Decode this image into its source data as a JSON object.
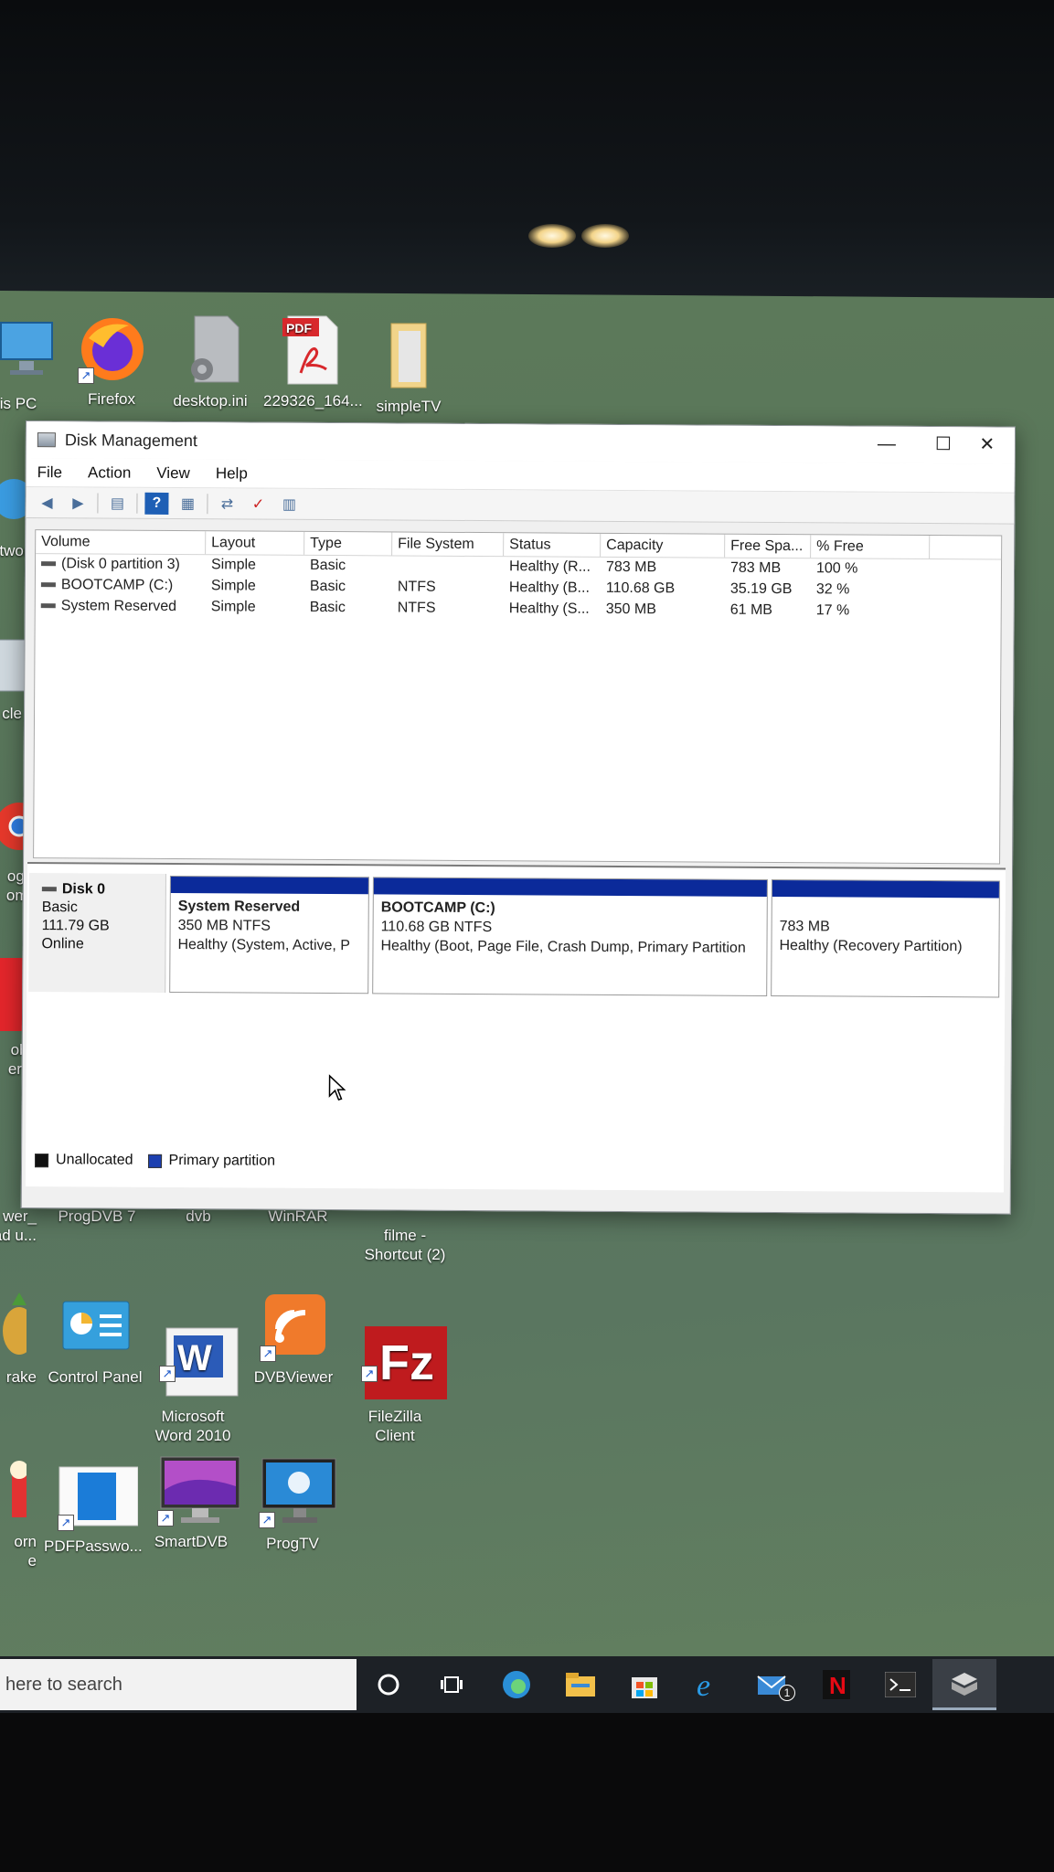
{
  "desktop": {
    "top_icons": [
      {
        "label": "is PC"
      },
      {
        "label": "Firefox"
      },
      {
        "label": "desktop.ini"
      },
      {
        "label": "229326_164..."
      },
      {
        "label": "simpleTV"
      }
    ],
    "left_edge_labels": [
      "twork",
      "cle B",
      "ogle",
      "ome",
      "obe",
      "er X",
      "wer_",
      "ad u...",
      "rake",
      "orn",
      "e"
    ],
    "row2_icons": [
      {
        "label": "ProgDVB 7"
      },
      {
        "label": "dvb"
      },
      {
        "label": "WinRAR"
      },
      {
        "label": "filme -\nShortcut (2)"
      }
    ],
    "row3_icons": [
      {
        "label": "Control Panel"
      },
      {
        "label": "Microsoft\nWord 2010"
      },
      {
        "label": "DVBViewer"
      },
      {
        "label": "FileZilla\nClient"
      }
    ],
    "row4_icons": [
      {
        "label": "PDFPasswo..."
      },
      {
        "label": "SmartDVB"
      },
      {
        "label": "ProgTV"
      }
    ]
  },
  "window": {
    "title": "Disk Management",
    "controls": {
      "minimize": "—",
      "maximize": "☐",
      "close": "✕"
    },
    "menu": [
      "File",
      "Action",
      "View",
      "Help"
    ],
    "columns": [
      "Volume",
      "Layout",
      "Type",
      "File System",
      "Status",
      "Capacity",
      "Free Spa...",
      "% Free"
    ],
    "volumes": [
      {
        "volume": "(Disk 0 partition 3)",
        "layout": "Simple",
        "type": "Basic",
        "fs": "",
        "status": "Healthy (R...",
        "capacity": "783 MB",
        "free": "783 MB",
        "pct": "100 %"
      },
      {
        "volume": "BOOTCAMP (C:)",
        "layout": "Simple",
        "type": "Basic",
        "fs": "NTFS",
        "status": "Healthy (B...",
        "capacity": "110.68 GB",
        "free": "35.19 GB",
        "pct": "32 %"
      },
      {
        "volume": "System Reserved",
        "layout": "Simple",
        "type": "Basic",
        "fs": "NTFS",
        "status": "Healthy (S...",
        "capacity": "350 MB",
        "free": "61 MB",
        "pct": "17 %"
      }
    ],
    "disk": {
      "name": "Disk 0",
      "type": "Basic",
      "size": "111.79 GB",
      "state": "Online"
    },
    "partitions": [
      {
        "name": "System Reserved",
        "size": "350 MB NTFS",
        "status": "Healthy (System, Active, P"
      },
      {
        "name": "BOOTCAMP  (C:)",
        "size": "110.68 GB NTFS",
        "status": "Healthy (Boot, Page File, Crash Dump, Primary Partition"
      },
      {
        "name": "",
        "size": "783 MB",
        "status": "Healthy (Recovery Partition)"
      }
    ],
    "legend": [
      {
        "label": "Unallocated",
        "color": "#111111"
      },
      {
        "label": "Primary partition",
        "color": "#1c3fb0"
      }
    ]
  },
  "taskbar": {
    "search_placeholder": "here to search",
    "icons": [
      "cortana-icon",
      "task-view-icon",
      "edge-icon",
      "file-explorer-icon",
      "store-icon",
      "internet-explorer-icon",
      "mail-icon",
      "netflix-icon",
      "terminal-icon",
      "app-icon"
    ],
    "mail_badge": "1"
  },
  "colors": {
    "desktop_bg": "#5d7a5a",
    "partition_bar": "#0b2a9a",
    "taskbar": "#1d2126"
  }
}
